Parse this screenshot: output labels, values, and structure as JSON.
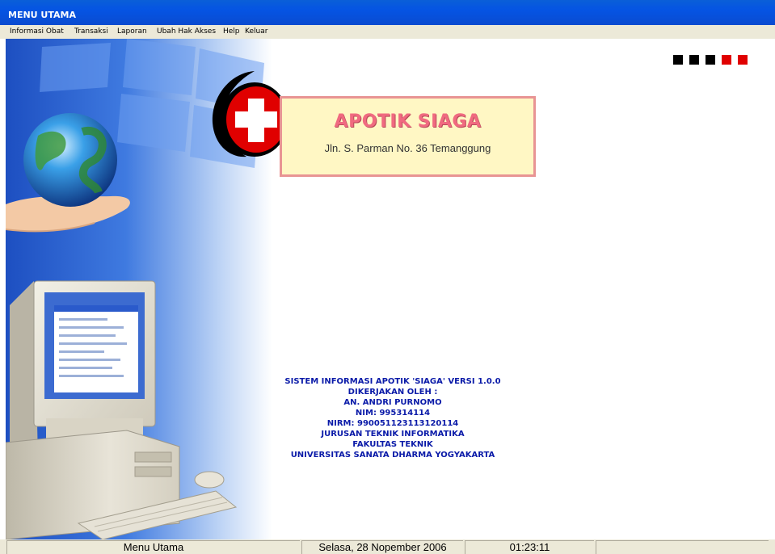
{
  "window": {
    "title": "MENU UTAMA"
  },
  "menu": [
    {
      "label": "Informasi Obat"
    },
    {
      "label": "Transaksi"
    },
    {
      "label": "Laporan"
    },
    {
      "label": "Ubah Hak Akses"
    },
    {
      "label": "Help"
    },
    {
      "label": "Keluar"
    }
  ],
  "logo": {
    "name": "APOTIK SIAGA",
    "address": "Jln. S. Parman No. 36 Temanggung",
    "cross_color": "#e00000"
  },
  "credits": {
    "lines": [
      "SISTEM INFORMASI APOTIK 'SIAGA' VERSI 1.0.0",
      "DIKERJAKAN OLEH :",
      "AN. ANDRI PURNOMO",
      "NIM: 995314114",
      "NIRM: 990051123113120114",
      "JURUSAN TEKNIK INFORMATIKA",
      "FAKULTAS TEKNIK",
      "UNIVERSITAS SANATA DHARMA YOGYAKARTA"
    ]
  },
  "indicators": [
    "#000000",
    "#000000",
    "#000000",
    "#e00000",
    "#e00000"
  ],
  "statusbar": {
    "form": "Menu Utama",
    "date": "Selasa, 28 Nopember 2006",
    "time": "01:23:11"
  }
}
